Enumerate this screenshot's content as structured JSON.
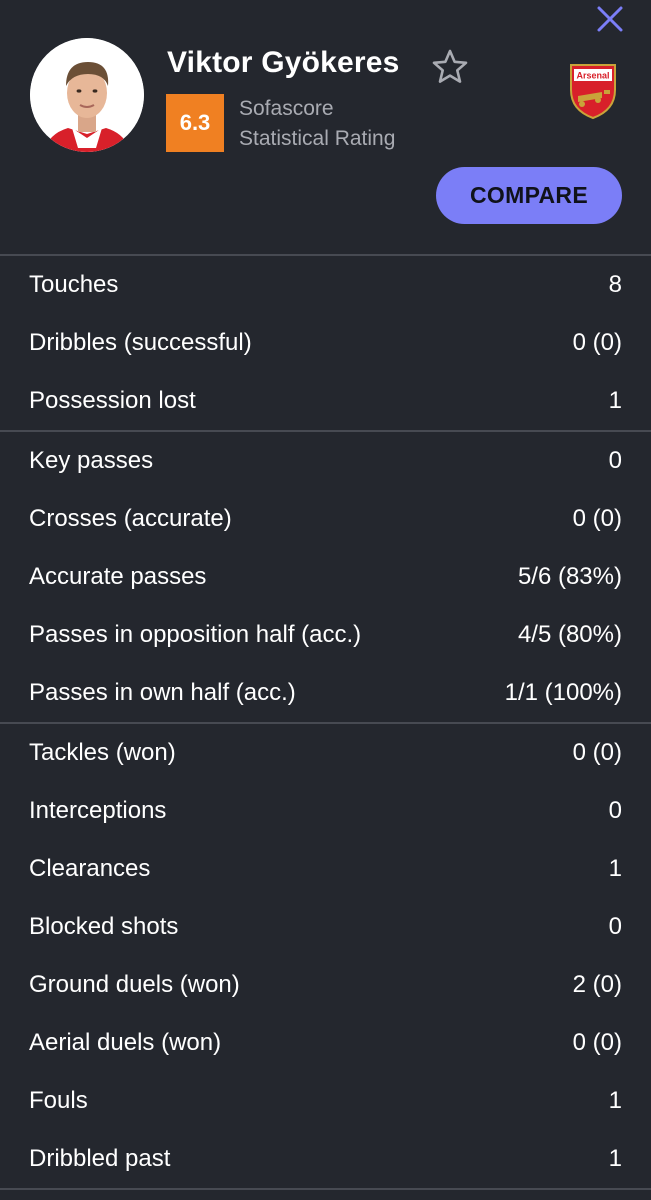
{
  "header": {
    "player_name": "Viktor Gyökeres",
    "rating": "6.3",
    "rating_label_line1": "Sofascore",
    "rating_label_line2": "Statistical Rating",
    "compare_label": "COMPARE",
    "club_crest_text": "Arsenal"
  },
  "colors": {
    "background": "#24272e",
    "rating_badge": "#f08022",
    "compare_button": "#7b7ef7",
    "close_icon": "#7b7ef7",
    "divider": "#474a52"
  },
  "icons": [
    "close-icon",
    "star-icon",
    "player-avatar",
    "club-crest"
  ],
  "groups": [
    {
      "rows": [
        {
          "label": "Touches",
          "value": "8"
        },
        {
          "label": "Dribbles (successful)",
          "value": "0 (0)"
        },
        {
          "label": "Possession lost",
          "value": "1"
        }
      ]
    },
    {
      "rows": [
        {
          "label": "Key passes",
          "value": "0"
        },
        {
          "label": "Crosses (accurate)",
          "value": "0 (0)"
        },
        {
          "label": "Accurate passes",
          "value": "5/6 (83%)"
        },
        {
          "label": "Passes in opposition half (acc.)",
          "value": "4/5 (80%)"
        },
        {
          "label": "Passes in own half (acc.)",
          "value": "1/1 (100%)"
        }
      ]
    },
    {
      "rows": [
        {
          "label": "Tackles (won)",
          "value": "0 (0)"
        },
        {
          "label": "Interceptions",
          "value": "0"
        },
        {
          "label": "Clearances",
          "value": "1"
        },
        {
          "label": "Blocked shots",
          "value": "0"
        },
        {
          "label": "Ground duels (won)",
          "value": "2 (0)"
        },
        {
          "label": "Aerial duels (won)",
          "value": "0 (0)"
        },
        {
          "label": "Fouls",
          "value": "1"
        },
        {
          "label": "Dribbled past",
          "value": "1"
        }
      ]
    }
  ]
}
